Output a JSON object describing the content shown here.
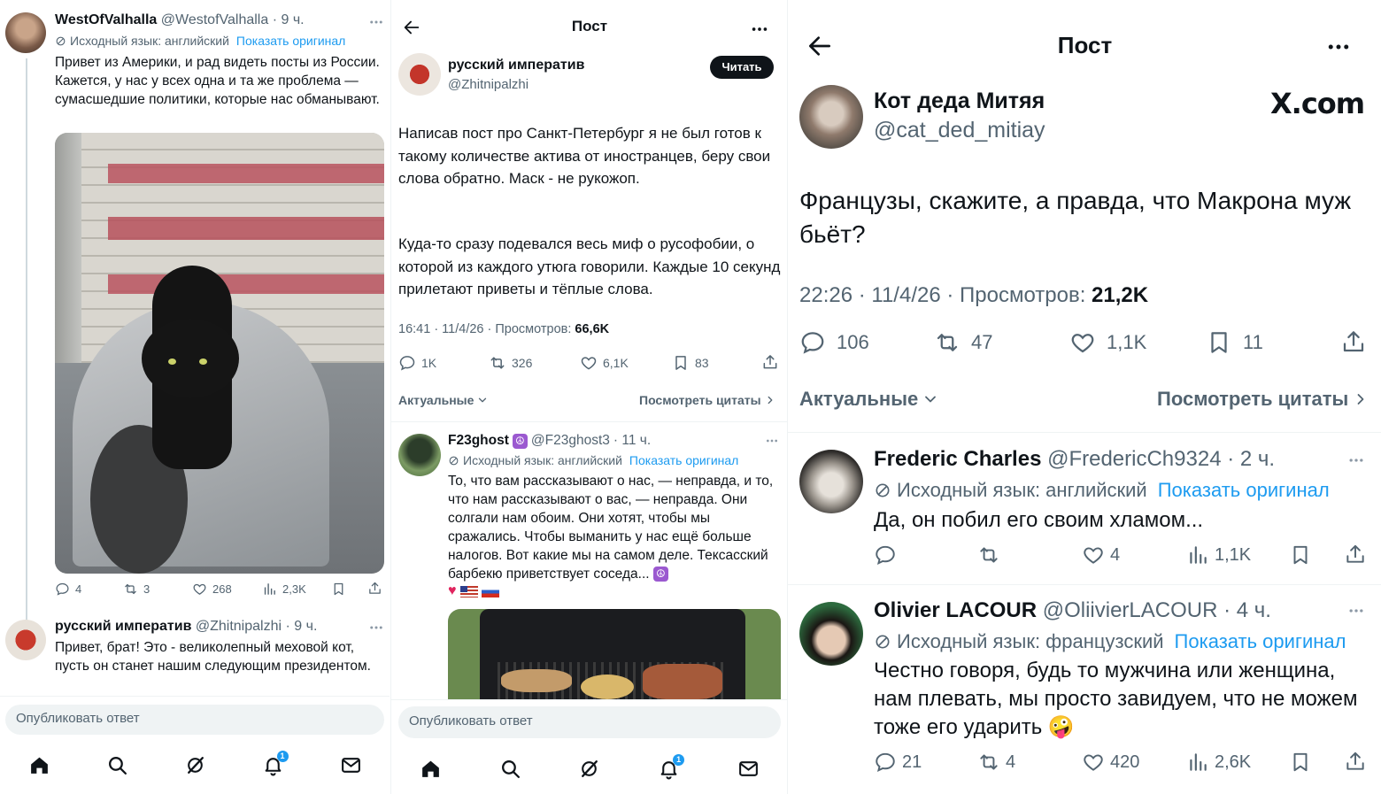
{
  "p1": {
    "tweet1": {
      "name": "WestOfValhalla",
      "handle": "@WestofValhalla",
      "time": "· 9 ч.",
      "lang_note": "Исходный язык: английский",
      "show_original": "Показать оригинал",
      "text": "Привет из Америки, и рад видеть посты из России. Кажется, у нас у всех одна и та же проблема — сумасшедшие политики, которые нас обманывают.",
      "replies": "4",
      "reposts": "3",
      "likes": "268",
      "views": "2,3K"
    },
    "tweet2": {
      "name": "русский императив",
      "handle": "@Zhitnipalzhi",
      "time": "· 9 ч.",
      "text": "Привет, брат! Это - великолепный меховой кот, пусть он станет нашим следующим президентом."
    },
    "reply_placeholder": "Опубликовать ответ",
    "notif_count": "1"
  },
  "p2": {
    "header_title": "Пост",
    "author_name": "русский императив",
    "author_handle": "@Zhitnipalzhi",
    "follow_label": "Читать",
    "text_p1": "Написав пост про Санкт-Петербург я не был готов к такому количестве актива от иностранцев, беру свои слова обратно. Маск - не рукожоп.",
    "text_p2": "Куда-то сразу подевался весь миф о русофобии, о которой из каждого утюга говорили. Каждые 10 секунд  прилетают приветы и тёплые слова.",
    "meta_time": "16:41 · 11/4/26 · Просмотров: ",
    "meta_views": "66,6K",
    "replies": "1K",
    "reposts": "326",
    "likes": "6,1K",
    "bookmarks": "83",
    "sort_label": "Актуальные",
    "quotes_label": "Посмотреть цитаты",
    "reply": {
      "name": "F23ghost",
      "handle": "@F23ghost3",
      "time": "· 11 ч.",
      "lang_note": "Исходный язык: английский",
      "show_original": "Показать оригинал",
      "text": "То, что вам рассказывают о нас, — неправда, и то, что нам рассказывают о вас, — неправда. Они солгали нам обоим. Они хотят, чтобы мы сражались. Чтобы выманить у нас ещё больше налогов. Вот какие мы на самом деле. Тексасский барбекю приветствует соседа..."
    },
    "reply_placeholder": "Опубликовать ответ",
    "notif_count": "1"
  },
  "p3": {
    "header_title": "Пост",
    "author_name": "Кот деда Митяя",
    "author_handle": "@cat_ded_mitiay",
    "watermark": "X.com",
    "text": "Французы, скажите, а правда, что Макрона муж бьёт?",
    "meta_time": "22:26 · 11/4/26 · Просмотров: ",
    "meta_views": "21,2K",
    "replies": "106",
    "reposts": "47",
    "likes": "1,1K",
    "bookmarks": "11",
    "sort_label": "Актуальные",
    "quotes_label": "Посмотреть цитаты",
    "reply1": {
      "name": "Frederic Charles",
      "handle": "@FredericCh9324",
      "time": "· 2 ч.",
      "lang_note": "Исходный язык: английский",
      "show_original": "Показать оригинал",
      "text": "Да, он побил его своим хламом...",
      "likes": "4",
      "views": "1,1K"
    },
    "reply2": {
      "name": "Olivier LACOUR",
      "handle": "@OliivierLACOUR",
      "time": "· 4 ч.",
      "lang_note": "Исходный язык: французский",
      "show_original": "Показать оригинал",
      "text": "Честно говоря, будь то мужчина или женщина, нам плевать, мы просто завидуем, что не можем тоже его ударить 🤪",
      "replies": "21",
      "reposts": "4",
      "likes": "420",
      "views": "2,6K"
    }
  }
}
